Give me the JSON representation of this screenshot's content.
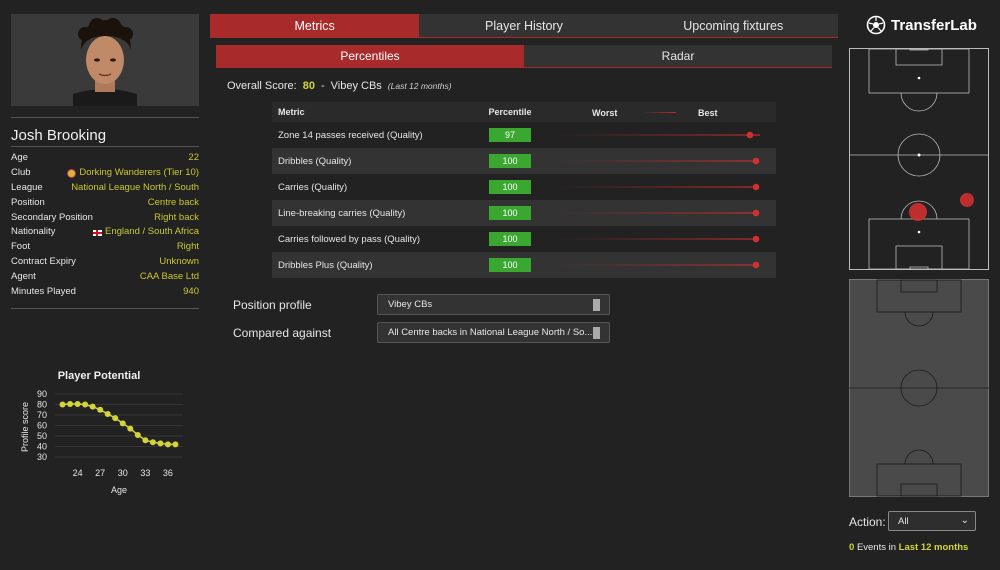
{
  "player": {
    "name": "Josh Brooking",
    "info": [
      {
        "key": "Age",
        "value": "22"
      },
      {
        "key": "Club",
        "value": "Dorking Wanderers (Tier 10)",
        "icon": "club-badge-icon"
      },
      {
        "key": "League",
        "value": "National League North / South"
      },
      {
        "key": "Position",
        "value": "Centre back"
      },
      {
        "key": "Secondary Position",
        "value": "Right back"
      },
      {
        "key": "Nationality",
        "value": "England / South Africa",
        "icon": "england-flag-icon"
      },
      {
        "key": "Foot",
        "value": "Right"
      },
      {
        "key": "Contract Expiry",
        "value": "Unknown"
      },
      {
        "key": "Agent",
        "value": "CAA Base Ltd"
      },
      {
        "key": "Minutes Played",
        "value": "940"
      }
    ]
  },
  "chart_data": {
    "type": "line",
    "title": "Player Potential",
    "xlabel": "Age",
    "ylabel": "Profile score",
    "x": [
      22,
      23,
      24,
      25,
      26,
      27,
      28,
      29,
      30,
      31,
      32,
      33,
      34,
      35,
      36,
      37
    ],
    "series": [
      {
        "values": [
          80,
          80.5,
          80.5,
          80,
          78,
          75,
          71,
          67,
          62,
          57,
          51,
          46,
          44,
          43,
          42,
          42
        ]
      }
    ],
    "xticks": [
      "24",
      "27",
      "30",
      "33",
      "36"
    ],
    "yticks": [
      "90",
      "80",
      "70",
      "60",
      "50",
      "40",
      "30"
    ],
    "xlim": [
      21,
      38
    ],
    "ylim": [
      30,
      90
    ],
    "grid": true,
    "color": "#d4d43a"
  },
  "tabs": {
    "main": [
      "Metrics",
      "Player History",
      "Upcoming fixtures"
    ],
    "sub": [
      "Percentiles",
      "Radar"
    ]
  },
  "overall": {
    "label": "Overall Score:",
    "score": "80",
    "separator": "-",
    "profile": "Vibey CBs",
    "period": "(Last 12 months)"
  },
  "metrics": {
    "headers": {
      "metric": "Metric",
      "percentile": "Percentile",
      "worst": "Worst",
      "best": "Best"
    },
    "rows": [
      {
        "name": "Zone 14 passes received (Quality)",
        "percentile": "97",
        "pct": 97
      },
      {
        "name": "Dribbles (Quality)",
        "percentile": "100",
        "pct": 100
      },
      {
        "name": "Carries (Quality)",
        "percentile": "100",
        "pct": 100
      },
      {
        "name": "Line-breaking carries (Quality)",
        "percentile": "100",
        "pct": 100
      },
      {
        "name": "Carries followed by pass (Quality)",
        "percentile": "100",
        "pct": 100
      },
      {
        "name": "Dribbles Plus (Quality)",
        "percentile": "100",
        "pct": 100
      }
    ]
  },
  "filters": {
    "position_profile": {
      "label": "Position profile",
      "value": "Vibey CBs"
    },
    "compared_against": {
      "label": "Compared against",
      "value": "All Centre backs in National League North / So..."
    }
  },
  "brand": {
    "name": "TransferLab"
  },
  "action": {
    "label": "Action:",
    "value": "All"
  },
  "events": {
    "count": "0",
    "text": "Events in",
    "period": "Last 12 months"
  },
  "colors": {
    "accent": "#a82a2a",
    "highlight": "#d4d43a",
    "good": "#3aa830",
    "dot": "#d03030"
  }
}
